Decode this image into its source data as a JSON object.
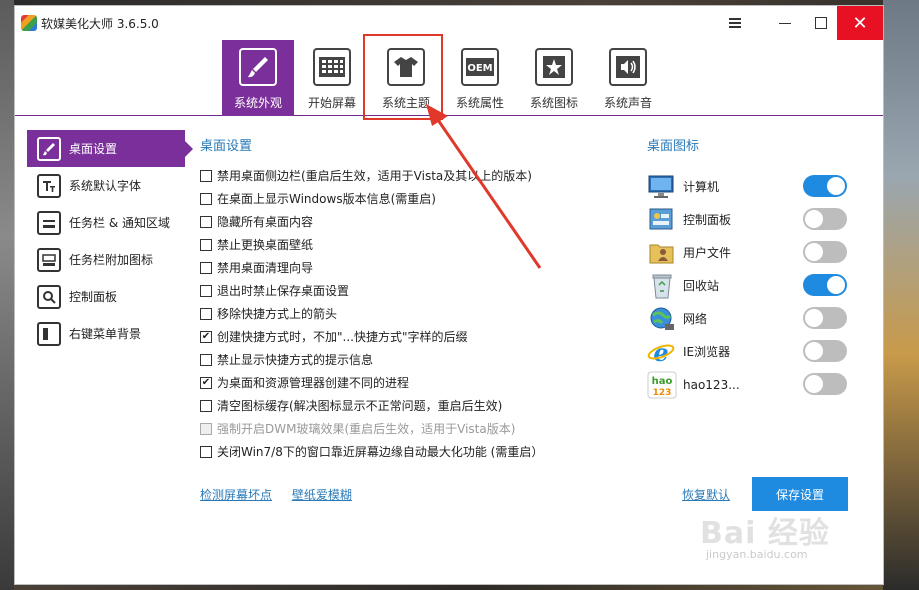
{
  "window": {
    "title": "软媒美化大师 3.6.5.0",
    "close_label": "✕"
  },
  "tabs": [
    {
      "label": "系统外观",
      "icon": "brush-icon",
      "active": true
    },
    {
      "label": "开始屏幕",
      "icon": "start-screen-icon",
      "active": false
    },
    {
      "label": "系统主题",
      "icon": "tshirt-icon",
      "active": false
    },
    {
      "label": "系统属性",
      "icon": "oem-icon",
      "active": false
    },
    {
      "label": "系统图标",
      "icon": "star-icon",
      "active": false
    },
    {
      "label": "系统声音",
      "icon": "speaker-icon",
      "active": false
    }
  ],
  "tab_oem_text": "OEM",
  "sidebar": {
    "items": [
      {
        "label": "桌面设置",
        "icon": "brush-icon",
        "active": true
      },
      {
        "label": "系统默认字体",
        "icon": "font-icon",
        "active": false
      },
      {
        "label": "任务栏 & 通知区域",
        "icon": "taskbar-icon",
        "active": false
      },
      {
        "label": "任务栏附加图标",
        "icon": "taskbar-extra-icon",
        "active": false
      },
      {
        "label": "控制面板",
        "icon": "control-panel-icon",
        "active": false
      },
      {
        "label": "右键菜单背景",
        "icon": "context-menu-icon",
        "active": false
      }
    ]
  },
  "desktop_settings": {
    "title": "桌面设置",
    "options": [
      {
        "label": "禁用桌面侧边栏(重启后生效，适用于Vista及其以上的版本)",
        "checked": false,
        "disabled": false
      },
      {
        "label": "在桌面上显示Windows版本信息(需重启)",
        "checked": false,
        "disabled": false
      },
      {
        "label": "隐藏所有桌面内容",
        "checked": false,
        "disabled": false
      },
      {
        "label": "禁止更换桌面壁纸",
        "checked": false,
        "disabled": false
      },
      {
        "label": "禁用桌面清理向导",
        "checked": false,
        "disabled": false
      },
      {
        "label": "退出时禁止保存桌面设置",
        "checked": false,
        "disabled": false
      },
      {
        "label": "移除快捷方式上的箭头",
        "checked": false,
        "disabled": false
      },
      {
        "label": "创建快捷方式时，不加\"...快捷方式\"字样的后缀",
        "checked": true,
        "disabled": false
      },
      {
        "label": "禁止显示快捷方式的提示信息",
        "checked": false,
        "disabled": false
      },
      {
        "label": "为桌面和资源管理器创建不同的进程",
        "checked": true,
        "disabled": false
      },
      {
        "label": "清空图标缓存(解决图标显示不正常问题，重启后生效)",
        "checked": false,
        "disabled": false
      },
      {
        "label": "强制开启DWM玻璃效果(重启后生效，适用于Vista版本)",
        "checked": false,
        "disabled": true
      },
      {
        "label": "关闭Win7/8下的窗口靠近屏幕边缘自动最大化功能 (需重启）",
        "checked": false,
        "disabled": false
      }
    ],
    "check_mark": "✔"
  },
  "desktop_icons": {
    "title": "桌面图标",
    "items": [
      {
        "label": "计算机",
        "icon": "computer-icon",
        "on": true
      },
      {
        "label": "控制面板",
        "icon": "control-panel-icon",
        "on": false
      },
      {
        "label": "用户文件",
        "icon": "user-folder-icon",
        "on": false
      },
      {
        "label": "回收站",
        "icon": "recycle-bin-icon",
        "on": true
      },
      {
        "label": "网络",
        "icon": "network-icon",
        "on": false
      },
      {
        "label": "IE浏览器",
        "icon": "ie-icon",
        "on": false
      },
      {
        "label": "hao123...",
        "icon": "hao123-icon",
        "on": false
      }
    ],
    "hao_text_top": "hao",
    "hao_text_bottom": "123",
    "ie_letter": "e"
  },
  "footer": {
    "detect_link": "检测屏幕坏点",
    "wallpaper_link": "壁纸爱模糊",
    "restore_link": "恢复默认",
    "save_button": "保存设置"
  },
  "watermark": {
    "text": "Bai  经验",
    "sub": "jingyan.baidu.com"
  },
  "colors": {
    "accent_purple": "#7b2f9a",
    "toggle_on": "#1f8be0",
    "link_blue": "#2a7ab8",
    "highlight_red": "#e0392b"
  }
}
